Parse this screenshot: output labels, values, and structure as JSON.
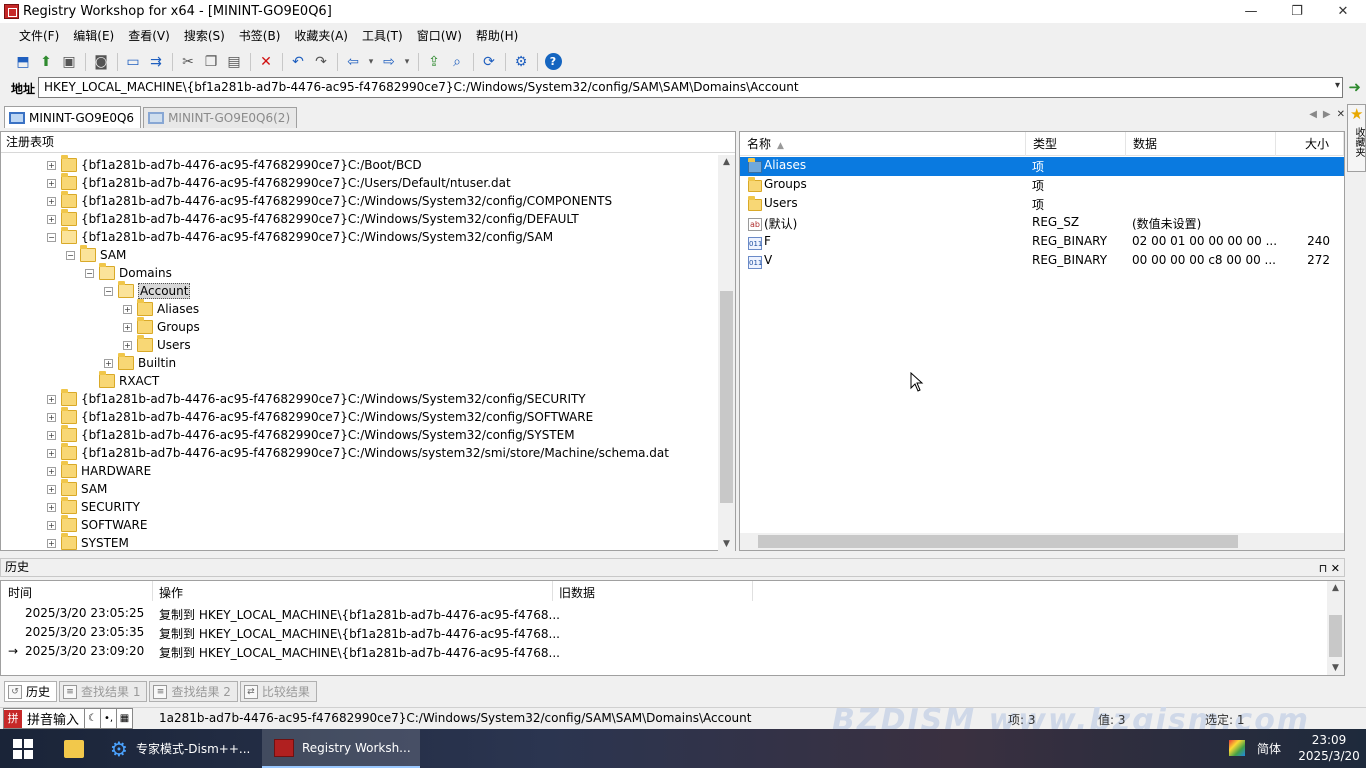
{
  "window": {
    "title": "Registry Workshop for x64 - [MININT-GO9E0Q6]",
    "controls": {
      "minimize": "—",
      "restore": "❐",
      "close": "✕"
    }
  },
  "menu": [
    "文件(F)",
    "编辑(E)",
    "查看(V)",
    "搜索(S)",
    "书签(B)",
    "收藏夹(A)",
    "工具(T)",
    "窗口(W)",
    "帮助(H)"
  ],
  "address": {
    "label": "地址",
    "value": "HKEY_LOCAL_MACHINE\\{bf1a281b-ad7b-4476-ac95-f47682990ce7}C:/Windows/System32/config/SAM\\SAM\\Domains\\Account"
  },
  "doc_tabs": [
    {
      "label": "MININT-GO9E0Q6",
      "active": true
    },
    {
      "label": "MININT-GO9E0Q6(2)",
      "active": false
    }
  ],
  "favorites_tab": "收藏夹",
  "tree": {
    "title": "注册表项",
    "nodes": [
      {
        "label": "{bf1a281b-ad7b-4476-ac95-f47682990ce7}C:/Boot/BCD",
        "expander": "+"
      },
      {
        "label": "{bf1a281b-ad7b-4476-ac95-f47682990ce7}C:/Users/Default/ntuser.dat",
        "expander": "+"
      },
      {
        "label": "{bf1a281b-ad7b-4476-ac95-f47682990ce7}C:/Windows/System32/config/COMPONENTS",
        "expander": "+"
      },
      {
        "label": "{bf1a281b-ad7b-4476-ac95-f47682990ce7}C:/Windows/System32/config/DEFAULT",
        "expander": "+"
      },
      {
        "label": "{bf1a281b-ad7b-4476-ac95-f47682990ce7}C:/Windows/System32/config/SAM",
        "expander": "−"
      },
      {
        "label": "SAM",
        "expander": "−"
      },
      {
        "label": "Domains",
        "expander": "−"
      },
      {
        "label": "Account",
        "expander": "−",
        "selected": true
      },
      {
        "label": "Aliases",
        "expander": "+"
      },
      {
        "label": "Groups",
        "expander": "+"
      },
      {
        "label": "Users",
        "expander": "+"
      },
      {
        "label": "Builtin",
        "expander": "+"
      },
      {
        "label": "RXACT",
        "expander": ""
      },
      {
        "label": "{bf1a281b-ad7b-4476-ac95-f47682990ce7}C:/Windows/System32/config/SECURITY",
        "expander": "+"
      },
      {
        "label": "{bf1a281b-ad7b-4476-ac95-f47682990ce7}C:/Windows/System32/config/SOFTWARE",
        "expander": "+"
      },
      {
        "label": "{bf1a281b-ad7b-4476-ac95-f47682990ce7}C:/Windows/System32/config/SYSTEM",
        "expander": "+"
      },
      {
        "label": "{bf1a281b-ad7b-4476-ac95-f47682990ce7}C:/Windows/system32/smi/store/Machine/schema.dat",
        "expander": "+"
      },
      {
        "label": "HARDWARE",
        "expander": "+"
      },
      {
        "label": "SAM",
        "expander": "+"
      },
      {
        "label": "SECURITY",
        "expander": "+"
      },
      {
        "label": "SOFTWARE",
        "expander": "+"
      },
      {
        "label": "SYSTEM",
        "expander": "+"
      }
    ]
  },
  "values_list": {
    "columns": [
      "名称",
      "类型",
      "数据",
      "大小"
    ],
    "rows": [
      {
        "name": "Aliases",
        "type": "项",
        "data": "",
        "size": "",
        "icon": "folder-icon",
        "selected": true
      },
      {
        "name": "Groups",
        "type": "项",
        "data": "",
        "size": "",
        "icon": "folder-icon"
      },
      {
        "name": "Users",
        "type": "项",
        "data": "",
        "size": "",
        "icon": "folder-icon"
      },
      {
        "name": "(默认)",
        "type": "REG_SZ",
        "data": "(数值未设置)",
        "size": "",
        "icon": "string-value-icon"
      },
      {
        "name": "F",
        "type": "REG_BINARY",
        "data": "02 00 01 00 00 00 00 ...",
        "size": "240",
        "icon": "binary-value-icon"
      },
      {
        "name": "V",
        "type": "REG_BINARY",
        "data": "00 00 00 00 c8 00 00 ...",
        "size": "272",
        "icon": "binary-value-icon"
      }
    ]
  },
  "history": {
    "title": "历史",
    "columns": [
      "时间",
      "操作",
      "旧数据"
    ],
    "rows": [
      {
        "time": "2025/3/20 23:05:25",
        "action": "复制到 HKEY_LOCAL_MACHINE\\{bf1a281b-ad7b-4476-ac95-f4768...",
        "current": false
      },
      {
        "time": "2025/3/20 23:05:35",
        "action": "复制到 HKEY_LOCAL_MACHINE\\{bf1a281b-ad7b-4476-ac95-f4768...",
        "current": false
      },
      {
        "time": "2025/3/20 23:09:20",
        "action": "复制到 HKEY_LOCAL_MACHINE\\{bf1a281b-ad7b-4476-ac95-f4768...",
        "current": true
      }
    ]
  },
  "bottom_tabs": [
    {
      "label": "历史",
      "active": true
    },
    {
      "label": "查找结果 1",
      "active": false
    },
    {
      "label": "查找结果 2",
      "active": false
    },
    {
      "label": "比较结果",
      "active": false
    }
  ],
  "status": {
    "ime": "拼音输入",
    "path": "1a281b-ad7b-4476-ac95-f47682990ce7}C:/Windows/System32/config/SAM\\SAM\\Domains\\Account",
    "watermark": "BZDJSM www.bzgjsm.com",
    "fields": [
      "项: 3",
      "值: 3",
      "选定: 1"
    ]
  },
  "taskbar": {
    "items": [
      {
        "label": "",
        "icon": "file-explorer-icon"
      },
      {
        "label": "专家模式-Dism++...",
        "icon": "dism-gear-icon"
      },
      {
        "label": "Registry Worksh...",
        "icon": "registry-workshop-icon",
        "active": true
      }
    ],
    "language": "简体",
    "time": "23:09",
    "date": "2025/3/20"
  }
}
